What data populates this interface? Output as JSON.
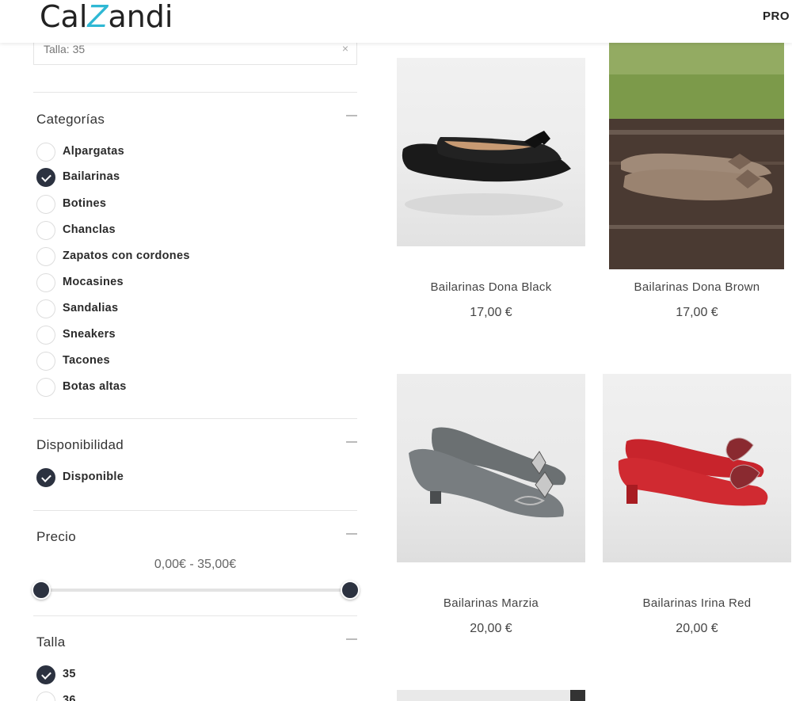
{
  "header": {
    "logo_left": "Cal",
    "logo_z": "Z",
    "logo_right": "andi",
    "nav_item": "PRO"
  },
  "filters": {
    "active_filter": "Talla: 35",
    "active_filter_close": "×",
    "categories": {
      "title": "Categorías",
      "items": [
        {
          "label": "Alpargatas",
          "checked": false
        },
        {
          "label": "Bailarinas",
          "checked": true
        },
        {
          "label": "Botines",
          "checked": false
        },
        {
          "label": "Chanclas",
          "checked": false
        },
        {
          "label": "Zapatos con cordones",
          "checked": false
        },
        {
          "label": "Mocasines",
          "checked": false
        },
        {
          "label": "Sandalias",
          "checked": false
        },
        {
          "label": "Sneakers",
          "checked": false
        },
        {
          "label": "Tacones",
          "checked": false
        },
        {
          "label": "Botas altas",
          "checked": false
        }
      ]
    },
    "availability": {
      "title": "Disponibilidad",
      "items": [
        {
          "label": "Disponible",
          "checked": true
        }
      ]
    },
    "price": {
      "title": "Precio",
      "range_text": "0,00€ - 35,00€"
    },
    "size": {
      "title": "Talla",
      "items": [
        {
          "label": "35",
          "checked": true
        },
        {
          "label": "36",
          "checked": false
        }
      ]
    }
  },
  "products": [
    {
      "name": "Bailarinas Dona Black",
      "price": "17,00 €"
    },
    {
      "name": "Bailarinas Dona Brown",
      "price": "17,00 €"
    },
    {
      "name": "Bailarinas Marzia",
      "price": "20,00 €"
    },
    {
      "name": "Bailarinas Irina Red",
      "price": "20,00 €"
    }
  ],
  "colors": {
    "accent": "#2c3240",
    "logo_z": "#2fb8d4",
    "red_shoe": "#c8242c",
    "black_shoe": "#1a1a1a",
    "grey_shoe": "#6b7072",
    "brown_shoe": "#a08a78"
  }
}
